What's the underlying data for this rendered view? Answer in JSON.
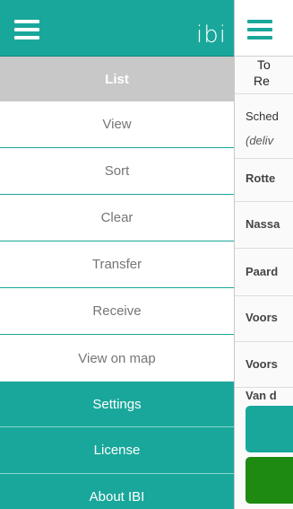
{
  "app": {
    "logo_text": "ibi",
    "colors": {
      "accent": "#1aa79b",
      "header_gray": "#c8c8c8",
      "menu_text": "#757575",
      "go_green": "#1e8a12"
    }
  },
  "drawer": {
    "list_header": "List",
    "list_items": [
      {
        "label": "View"
      },
      {
        "label": "Sort"
      },
      {
        "label": "Clear"
      },
      {
        "label": "Transfer"
      },
      {
        "label": "Receive"
      },
      {
        "label": "View on map"
      }
    ],
    "settings_items": [
      {
        "label": "Settings"
      },
      {
        "label": "License"
      },
      {
        "label": "About IBI"
      }
    ]
  },
  "background": {
    "headline_line1": "To",
    "headline_line2": "Re",
    "scheduled_label": "Sched",
    "delivery_note": "(deliv",
    "rows": [
      {
        "label": "Rotte"
      },
      {
        "label": "Nassa"
      },
      {
        "label": "Paard"
      },
      {
        "label": "Voors"
      },
      {
        "label": "Voors"
      },
      {
        "label": "Van d"
      }
    ]
  }
}
